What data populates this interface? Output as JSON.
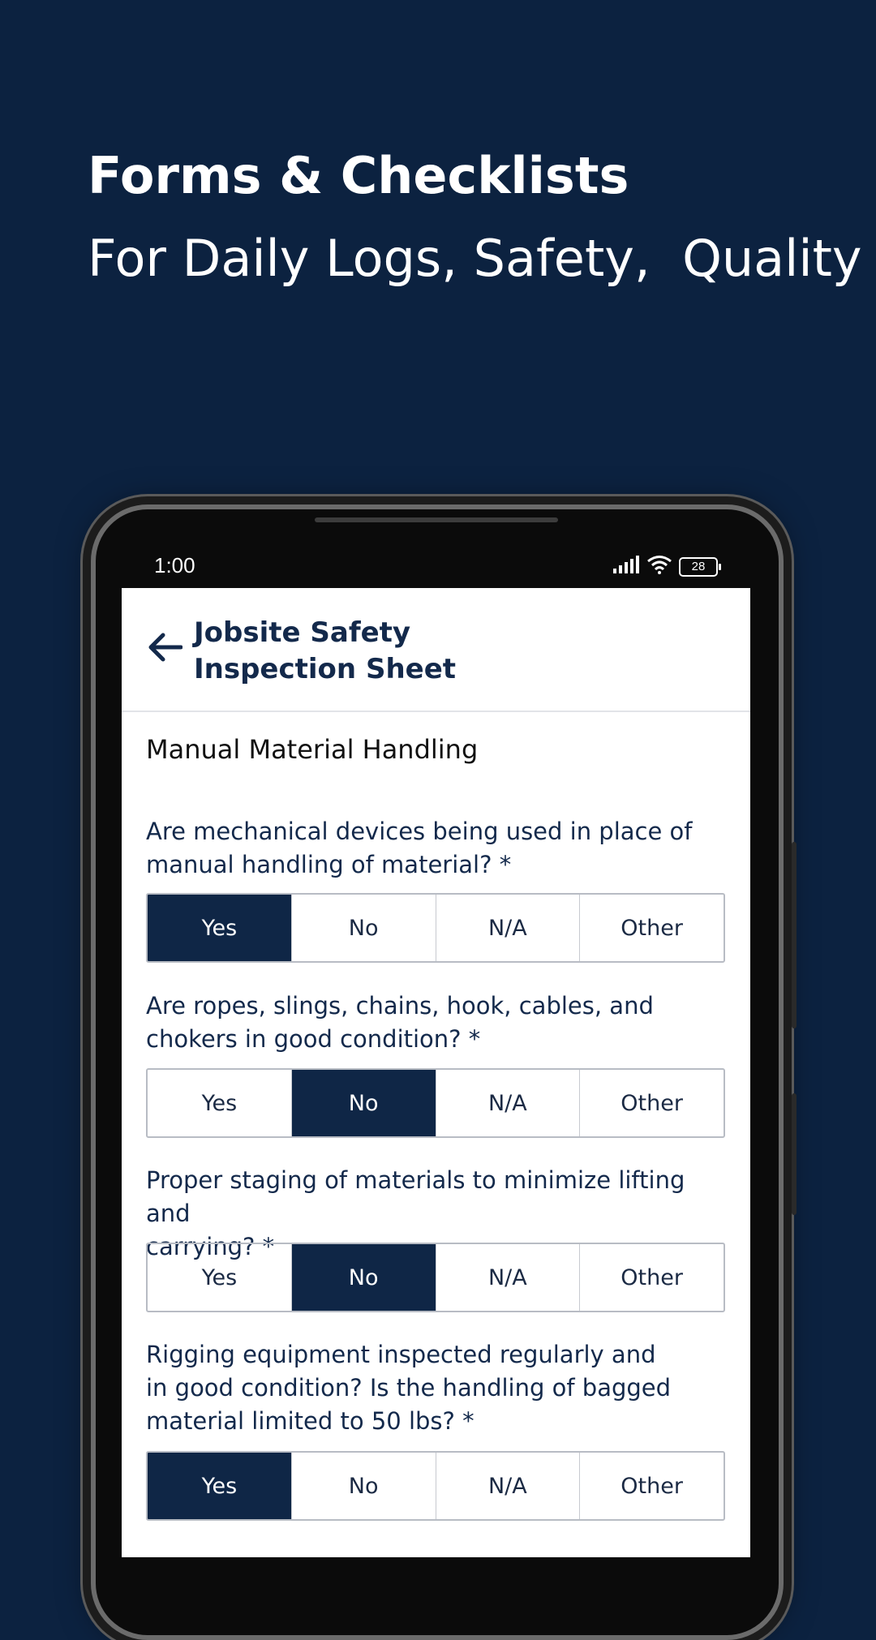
{
  "promo": {
    "headline": "Forms & Checklists",
    "subheadline": "For Daily Logs, Safety,  Quality"
  },
  "status_bar": {
    "time": "1:00",
    "battery": "28",
    "icons": [
      "signal-icon",
      "wifi-icon",
      "battery-icon"
    ]
  },
  "app_bar": {
    "back_icon": "arrow-left-icon",
    "title_line1": "Jobsite Safety",
    "title_line2": "Inspection Sheet"
  },
  "section": {
    "title": "Manual Material Handling"
  },
  "options": [
    "Yes",
    "No",
    "N/A",
    "Other"
  ],
  "questions": [
    {
      "line1": "Are mechanical devices being used in place of",
      "line2": "manual handling of material? *",
      "line3": "",
      "selected": "Yes"
    },
    {
      "line1": "Are ropes, slings, chains, hook, cables, and",
      "line2": "chokers in good condition? *",
      "line3": "",
      "selected": "No"
    },
    {
      "line1": "Proper staging of materials to minimize lifting and",
      "line2": "carrying? *",
      "line3": "",
      "selected": "No"
    },
    {
      "line1": "Rigging equipment inspected regularly and",
      "line2": "in good condition? Is the handling of bagged",
      "line3": "material limited to 50 lbs? *",
      "selected": "Yes"
    }
  ],
  "colors": {
    "background": "#0c2240",
    "accent": "#0f2646",
    "text_dark": "#13294b"
  }
}
